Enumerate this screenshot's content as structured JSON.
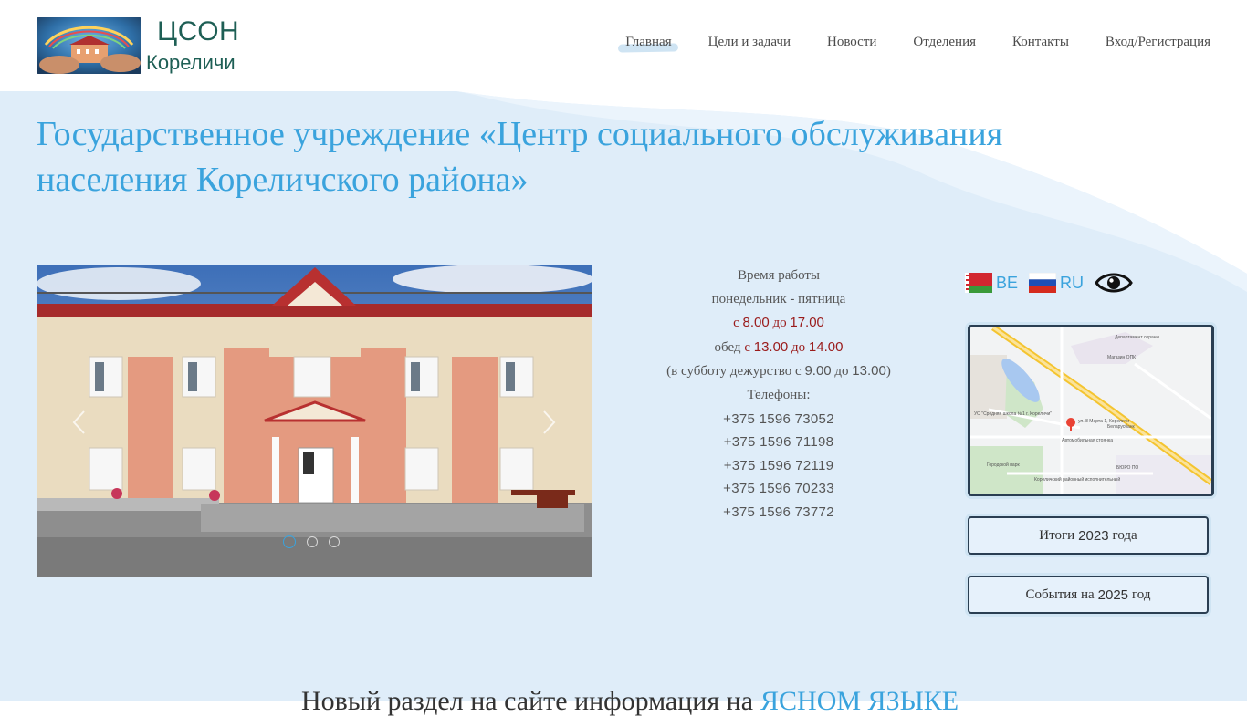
{
  "header": {
    "logo_line1": "ЦСОН",
    "logo_line2": "Кореличи",
    "nav": [
      {
        "label": "Главная"
      },
      {
        "label": "Цели и задачи"
      },
      {
        "label": "Новости"
      },
      {
        "label": "Отделения"
      },
      {
        "label": "Контакты"
      },
      {
        "label": "Вход/Регистрация"
      }
    ]
  },
  "main": {
    "title": "Государственное учреждение «Центр социального обслуживания населения Кореличского района»"
  },
  "slider": {
    "slide_count": 3,
    "active_index": 0
  },
  "info": {
    "heading": "Время работы",
    "days": "понедельник - пятница",
    "hours_from": "с",
    "hours_start": "8.00",
    "hours_to": "до",
    "hours_end": "17.00",
    "lunch_prefix": "обед",
    "lunch_from": "с",
    "lunch_start": "13.00",
    "lunch_to": "до",
    "lunch_end": "14.00",
    "saturday_a": "(в субботу дежурство с ",
    "saturday_start": "9.00",
    "saturday_b": " до ",
    "saturday_end": "13.00",
    "saturday_c": ")",
    "phones_label": "Телефоны:",
    "phones": [
      "+375 1596 73052",
      "+375 1596 71198",
      "+375 1596 72119",
      "+375 1596 70233",
      "+375 1596 73772"
    ]
  },
  "languages": [
    {
      "code": "BE"
    },
    {
      "code": "RU"
    }
  ],
  "map": {
    "labels": [
      "УО \"Средняя школа №1 г. Кореличи\"",
      "ул. 8 Марта 1, Кореличи",
      "Беларусбанк",
      "Автомобильная стоянка",
      "Департамент охраны",
      "Магазин ОПК",
      "Городской парк",
      "БЮРО ПО",
      "Кореличский районный исполнительный"
    ]
  },
  "buttons": {
    "results_label_a": "Итоги",
    "results_year": "2023",
    "results_label_b": "года",
    "events_label_a": "События на",
    "events_year": "2025",
    "events_label_b": "год"
  },
  "bottom": {
    "text_a": "Новый раздел на сайте информация на",
    "text_b": "ЯСНОМ ЯЗЫКЕ"
  },
  "colors": {
    "accent": "#3aa3dd",
    "dark_red": "#9a1b1b",
    "logo_green": "#1e5f55",
    "bg_blue": "#dfedf9"
  }
}
